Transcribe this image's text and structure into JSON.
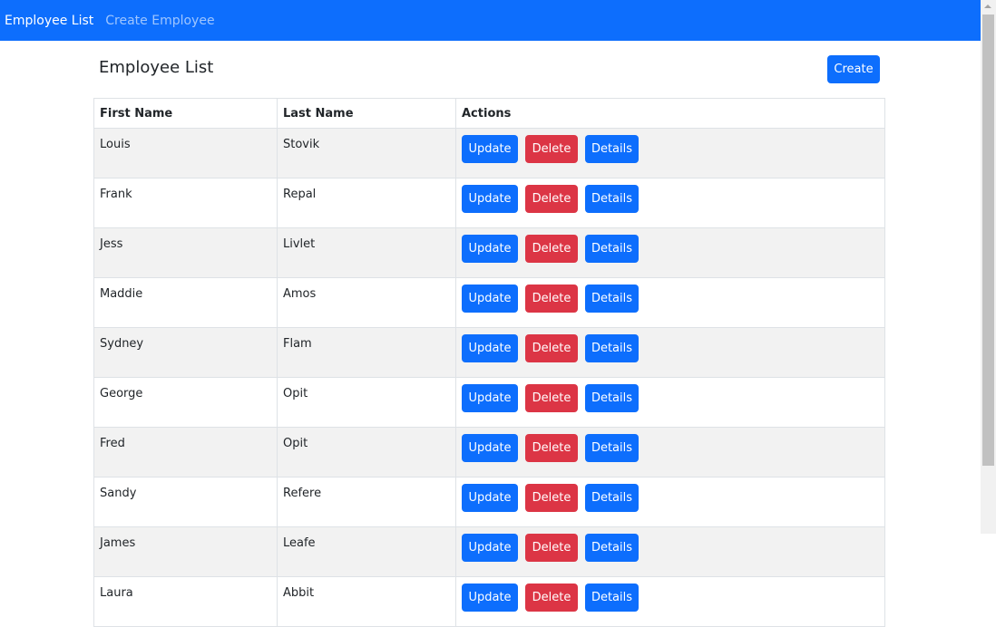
{
  "navbar": {
    "brand": "Employee List",
    "links": [
      "Create Employee"
    ]
  },
  "page": {
    "title": "Employee List",
    "create_label": "Create"
  },
  "table": {
    "headers": [
      "First Name",
      "Last Name",
      "Actions"
    ],
    "action_labels": {
      "update": "Update",
      "delete": "Delete",
      "details": "Details"
    },
    "rows": [
      {
        "first": "Louis",
        "last": "Stovik"
      },
      {
        "first": "Frank",
        "last": "Repal"
      },
      {
        "first": "Jess",
        "last": "Livlet"
      },
      {
        "first": "Maddie",
        "last": "Amos"
      },
      {
        "first": "Sydney",
        "last": "Flam"
      },
      {
        "first": "George",
        "last": "Opit"
      },
      {
        "first": "Fred",
        "last": "Opit"
      },
      {
        "first": "Sandy",
        "last": "Refere"
      },
      {
        "first": "James",
        "last": "Leafe"
      },
      {
        "first": "Laura",
        "last": "Abbit"
      }
    ]
  },
  "colors": {
    "primary": "#0d6efd",
    "danger": "#dc3545",
    "stripe": "#f2f2f2"
  }
}
